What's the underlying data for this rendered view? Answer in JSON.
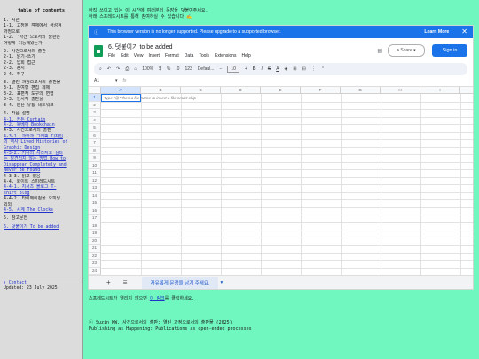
{
  "toc": {
    "title": "table of contents",
    "items": [
      {
        "text": "1. 서론",
        "link": false
      },
      {
        "text": "1-1. 고정된 객체에서 생성적",
        "link": false
      },
      {
        "text": "과정으로",
        "link": false
      },
      {
        "text": "1-2. '사건'으로서의 출판은",
        "link": false
      },
      {
        "text": "어떻게 기능해왔는가",
        "link": false
      },
      {
        "text": "",
        "link": false
      },
      {
        "text": "2. 사건으로서의 출판",
        "link": false
      },
      {
        "text": "2-1. 읽기-쓰기",
        "link": false
      },
      {
        "text": "2-2. 입회 접근",
        "link": false
      },
      {
        "text": "2-3. 동시",
        "link": false
      },
      {
        "text": "2-4. 허구",
        "link": false
      },
      {
        "text": "",
        "link": false
      },
      {
        "text": "3. 열린 과정으로서의 출판물",
        "link": false
      },
      {
        "text": "3-1. 참여형 편집 체제",
        "link": false
      },
      {
        "text": "3-2. 표편적 도구의 변형",
        "link": false
      },
      {
        "text": "3-3. 인시적 출판물",
        "link": false
      },
      {
        "text": "3-4. 분산 유통 네트워크",
        "link": false
      },
      {
        "text": "",
        "link": false
      },
      {
        "text": "4. 작품 설명",
        "link": false
      },
      {
        "text": "4-1. 커튼 Curtain",
        "link": true
      },
      {
        "text": "4-2. 북베어 Bookchain",
        "link": true
      },
      {
        "text": "4-3. 사건으로서의 출판",
        "link": false
      },
      {
        "text": "4-3-1. 과학과 그래픽 디자인",
        "link": true
      },
      {
        "text": "의 역사 Lived Histories of",
        "link": true
      },
      {
        "text": "Graphic Design",
        "link": true
      },
      {
        "text": "4-3-2. 커뮤의 사라지고 싶다",
        "link": true
      },
      {
        "text": "는 발견되지 않는 방법 How to",
        "link": true
      },
      {
        "text": "Disappear Completely and",
        "link": true
      },
      {
        "text": "Never Be Found",
        "link": true
      },
      {
        "text": "4-3-3. 읽고 있음",
        "link": false
      },
      {
        "text": "4-4. 화이트 스피레드시트",
        "link": false
      },
      {
        "text": "4-4-1. 지서츠 블로그 T-",
        "link": true
      },
      {
        "text": "shirt Blog",
        "link": true
      },
      {
        "text": "4-4-2. 타이메이컴을 오피닝",
        "link": false
      },
      {
        "text": "외외",
        "link": false
      },
      {
        "text": "4-5. 시계 The Clocks",
        "link": true
      },
      {
        "text": "",
        "link": false
      },
      {
        "text": "5. 참고문헌",
        "link": false
      },
      {
        "text": "",
        "link": false
      },
      {
        "text": "6. 덧붙이기 To be added",
        "link": true
      }
    ],
    "contact": "↑ Contact",
    "updated": "Updated: 23 July 2025"
  },
  "intro": {
    "line1": "아직 쓰이고 있는 이 시간에 여러분의 문장을 덧붙여주세요.",
    "line2": "아래 스프레드시트를 통해 참여하실 수 있습니다 ✍️"
  },
  "sheet": {
    "banner_msg": "This browser version is no longer supported. Please upgrade to a supported browser.",
    "learn_more": "Learn More",
    "close": "✕",
    "title": "6. 덧붙이기 to be added",
    "menu": [
      "File",
      "Edit",
      "View",
      "Insert",
      "Format",
      "Data",
      "Tools",
      "Extensions",
      "Help"
    ],
    "share": "Share",
    "sign_in": "Sign in",
    "zoom": "100%",
    "font": "Defaul...",
    "font_size": "10",
    "cell_ref": "A1",
    "fx": "fx",
    "columns": [
      "A",
      "B",
      "C",
      "D",
      "E",
      "F",
      "G",
      "H",
      "I",
      "J"
    ],
    "rows": [
      "1",
      "2",
      "3",
      "4",
      "5",
      "6",
      "7",
      "8",
      "9",
      "10",
      "11",
      "12",
      "13",
      "14",
      "15",
      "16",
      "17",
      "18",
      "19",
      "20",
      "21",
      "22",
      "23",
      "24",
      "25",
      "26",
      "27",
      "28",
      "29"
    ],
    "hint": "Type \"@\" then a file name to insert a file smart chip",
    "sheet_tab": "자유롭게 문장을 남겨 주세요.",
    "add_sheet": "+",
    "all_sheets": "☰"
  },
  "below": {
    "prefix": "스프레드시트가 열리지 않으면 ",
    "link": "이 링크",
    "suffix": "를 클릭하세요."
  },
  "footer": {
    "line1": "ⓒ Suzin KW. 사건으로서의 출판: 열린 과정으로서의 출판물 (2025)",
    "line2": "Publishing as Happening: Publications as open-ended processes"
  },
  "colors": {
    "background": "#6ff7bf",
    "sidebar": "#dcdcdc",
    "accent": "#1a73e8"
  }
}
